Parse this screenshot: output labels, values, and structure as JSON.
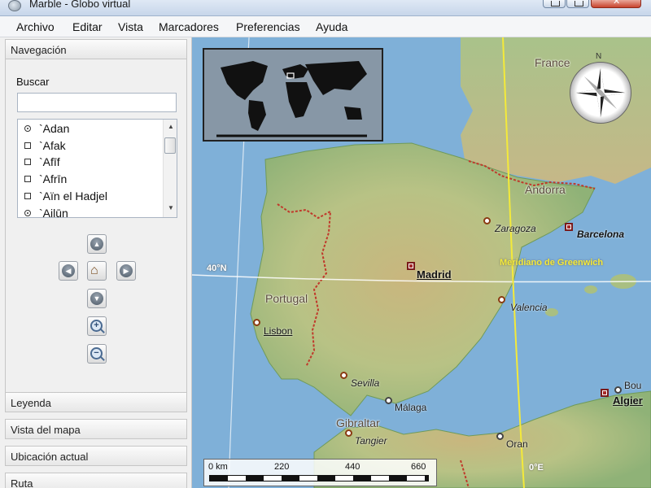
{
  "window": {
    "title": "Marble - Globo virtual",
    "icon": "globe-icon"
  },
  "menu": [
    "Archivo",
    "Editar",
    "Vista",
    "Marcadores",
    "Preferencias",
    "Ayuda"
  ],
  "left_panel": {
    "navigation_header": "Navegación",
    "search_label": "Buscar",
    "search_value": "",
    "places": [
      {
        "name": "`Adan",
        "marker": "round"
      },
      {
        "name": "`Afak",
        "marker": "square"
      },
      {
        "name": "`Afīf",
        "marker": "square"
      },
      {
        "name": "`Afrīn",
        "marker": "square"
      },
      {
        "name": "`Aïn el Hadjel",
        "marker": "square"
      },
      {
        "name": "`Ailūn",
        "marker": "round"
      }
    ],
    "nav_buttons": [
      "up-arrow-icon",
      "left-arrow-icon",
      "home-icon",
      "right-arrow-icon",
      "down-arrow-icon",
      "zoom-in-icon",
      "zoom-out-icon"
    ],
    "sections": [
      "Leyenda",
      "Vista del mapa",
      "Ubicación actual",
      "Ruta"
    ]
  },
  "map": {
    "countries": [
      "France",
      "Andorra",
      "Portugal",
      "Gibraltar"
    ],
    "cities": {
      "madrid": "Madrid",
      "barcelona": "Barcelona",
      "zaragoza": "Zaragoza",
      "valencia": "Valencia",
      "lisbon": "Lisbon",
      "sevilla": "Sevilla",
      "malaga": "Málaga",
      "tangier": "Tangier",
      "oran": "Oran",
      "algiers": "Algier",
      "bou": "Bou"
    },
    "latitude_label": "40°N",
    "meridian_label": "Meridiano de Greenwich",
    "meridian_degree": "0°E",
    "compass_north": "N",
    "scale": {
      "labels": [
        "0 km",
        "220",
        "440",
        "660"
      ]
    },
    "colors": {
      "sea": "#7fb0d8",
      "land": "#b9c487",
      "meridian": "#f4ea3a",
      "border": "#c0392b"
    }
  }
}
